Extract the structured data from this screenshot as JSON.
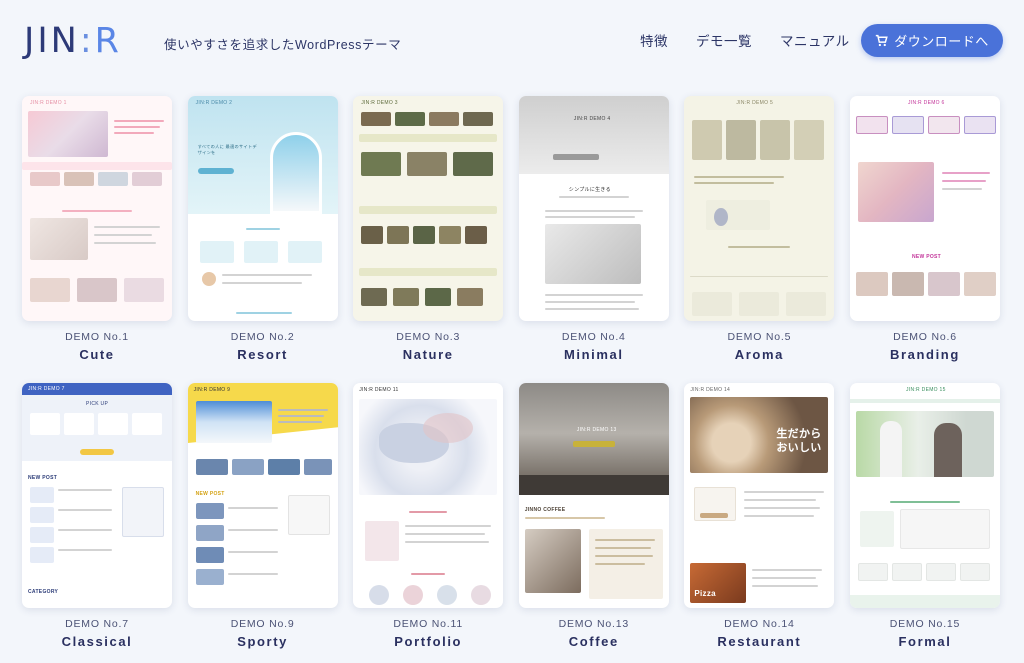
{
  "header": {
    "logo": "JIN:R",
    "tagline": "使いやすさを追求したWordPressテーマ",
    "nav": [
      "特徴",
      "デモ一覧",
      "マニュアル"
    ],
    "download_label": "ダウンロードへ"
  },
  "demos": [
    {
      "num": "DEMO No.1",
      "name": "Cute",
      "theme": "cute"
    },
    {
      "num": "DEMO No.2",
      "name": "Resort",
      "theme": "resort"
    },
    {
      "num": "DEMO No.3",
      "name": "Nature",
      "theme": "nature"
    },
    {
      "num": "DEMO No.4",
      "name": "Minimal",
      "theme": "minimal"
    },
    {
      "num": "DEMO No.5",
      "name": "Aroma",
      "theme": "aroma"
    },
    {
      "num": "DEMO No.6",
      "name": "Branding",
      "theme": "branding"
    },
    {
      "num": "DEMO No.7",
      "name": "Classical",
      "theme": "classical"
    },
    {
      "num": "DEMO No.9",
      "name": "Sporty",
      "theme": "sporty"
    },
    {
      "num": "DEMO No.11",
      "name": "Portfolio",
      "theme": "portfolio"
    },
    {
      "num": "DEMO No.13",
      "name": "Coffee",
      "theme": "coffee"
    },
    {
      "num": "DEMO No.14",
      "name": "Restaurant",
      "theme": "restaurant"
    },
    {
      "num": "DEMO No.15",
      "name": "Formal",
      "theme": "formal"
    }
  ],
  "thumbs": {
    "cute": {
      "title": "JIN:R DEMO 1"
    },
    "resort": {
      "title": "JIN:R DEMO 2",
      "hero": "すべての人に 最適のサイトデザインを"
    },
    "nature": {
      "title": "JIN:R DEMO 3"
    },
    "minimal": {
      "title": "JIN:R DEMO 4",
      "heading": "シンプルに生きる"
    },
    "aroma": {
      "title": "JIN:R DEMO 5"
    },
    "branding": {
      "title": "JIN:R DEMO 6",
      "section": "NEW POST"
    },
    "classical": {
      "title": "JIN:R DEMO 7",
      "pickup": "PICK UP",
      "newpost": "NEW POST",
      "category": "CATEGORY"
    },
    "sporty": {
      "title": "JIN:R DEMO 9",
      "newpost": "NEW POST"
    },
    "portfolio": {
      "title": "JIN:R DEMO 11"
    },
    "coffee": {
      "title": "JIN:R DEMO 13",
      "shop": "JINNO COFFEE"
    },
    "restaurant": {
      "title": "JIN:R DEMO 14",
      "hero1": "生だから",
      "hero2": "おいしい",
      "pizza": "Pizza"
    },
    "formal": {
      "title": "JIN:R DEMO 15"
    }
  },
  "colors": {
    "accent": "#4a72d9",
    "text": "#2c3566",
    "background": "#f3f6fb"
  }
}
